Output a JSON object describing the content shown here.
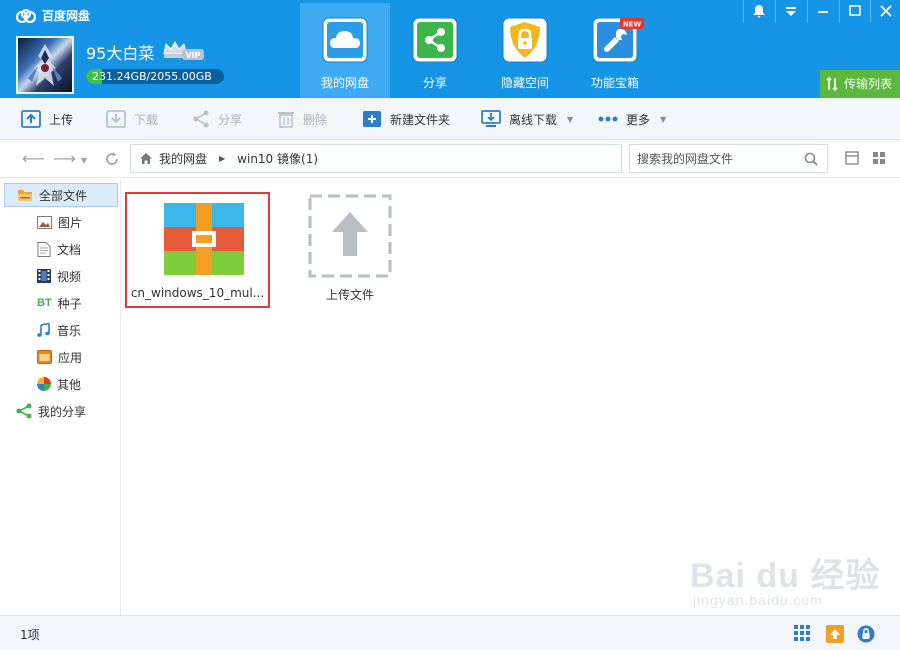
{
  "app": {
    "title": "百度网盘"
  },
  "user": {
    "name": "95大白菜",
    "vip_label": "VIP",
    "quota_text": "231.24GB/2055.00GB",
    "quota_fraction": 0.1125
  },
  "nav_tabs": [
    {
      "label": "我的网盘",
      "icon": "cloud-icon",
      "active": true
    },
    {
      "label": "分享",
      "icon": "share-icon",
      "active": false
    },
    {
      "label": "隐藏空间",
      "icon": "lock-icon",
      "active": false
    },
    {
      "label": "功能宝箱",
      "icon": "wrench-icon",
      "active": false,
      "badge": "NEW"
    }
  ],
  "window_controls": [
    "notification-icon",
    "menu-icon",
    "minimize-icon",
    "maximize-icon",
    "close-icon"
  ],
  "transfer": {
    "label": "传输列表"
  },
  "toolbar": {
    "upload": "上传",
    "download": "下载",
    "share": "分享",
    "delete": "删除",
    "new_folder": "新建文件夹",
    "offline_download": "离线下载",
    "more": "更多"
  },
  "address": {
    "breadcrumb": [
      "我的网盘",
      "win10 镜像(1)"
    ],
    "search_placeholder": "搜索我的网盘文件"
  },
  "sidebar": {
    "items": [
      {
        "label": "全部文件",
        "icon": "folder-icon",
        "active": true
      },
      {
        "label": "图片",
        "icon": "image-icon"
      },
      {
        "label": "文档",
        "icon": "document-icon"
      },
      {
        "label": "视频",
        "icon": "video-icon"
      },
      {
        "label": "种子",
        "icon": "bt-icon",
        "icon_text": "BT"
      },
      {
        "label": "音乐",
        "icon": "music-icon"
      },
      {
        "label": "应用",
        "icon": "app-icon"
      },
      {
        "label": "其他",
        "icon": "other-icon"
      },
      {
        "label": "我的分享",
        "icon": "share-icon"
      }
    ]
  },
  "files": [
    {
      "name": "cn_windows_10_mul...",
      "type": "archive"
    }
  ],
  "upload_tile": {
    "label": "上传文件"
  },
  "status": {
    "count": "1项"
  },
  "watermark": {
    "main": "Bai du 经验",
    "sub": "jingyan.baidu.com"
  },
  "colors": {
    "header": "#1694e6",
    "active_tab": "#3eaaf2",
    "transfer": "#5cb83c",
    "selection": "#e03c3c"
  }
}
